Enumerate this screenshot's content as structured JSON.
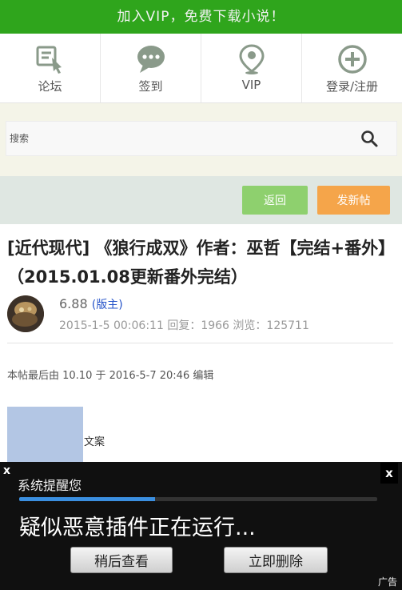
{
  "banner": {
    "text": "加入VIP，免费下载小说！"
  },
  "nav": {
    "items": [
      {
        "label": "论坛",
        "icon": "forum-icon"
      },
      {
        "label": "签到",
        "icon": "chat-bubble-icon"
      },
      {
        "label": "VIP",
        "icon": "location-pin-icon"
      },
      {
        "label": "登录/注册",
        "icon": "plus-circle-icon"
      }
    ],
    "icon_color": "#8a9a8a"
  },
  "search": {
    "placeholder": "搜索",
    "button_icon": "search-icon"
  },
  "actions": {
    "back_label": "返回",
    "new_post_label": "发新帖",
    "back_color": "#8ed06e",
    "post_color": "#f5a54a"
  },
  "thread": {
    "title": "[近代现代] 《狼行成双》作者：巫哲【完结+番外】（2015.01.08更新番外完结）",
    "author": "6.88",
    "role": "版主",
    "posted": "2015-1-5 00:06:11",
    "replies_label": "回复：",
    "replies": "1966",
    "views_label": "浏览：",
    "views": "125711",
    "edit_note": "本帖最后由 10.10 于 2016-5-7 20:46 编辑",
    "caption": "文案"
  },
  "popup": {
    "title": "系统提醒您",
    "message": "疑似恶意插件正在运行...",
    "progress": 0.38,
    "later_label": "稍后查看",
    "delete_label": "立即删除",
    "ad_label": "广告",
    "close_left": "x",
    "close_right": "x"
  }
}
